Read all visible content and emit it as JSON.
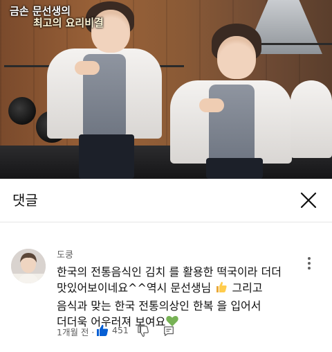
{
  "video": {
    "show_title_line1": "금손 문선생의",
    "show_title_line2": "최고의 요리비결"
  },
  "comments_panel": {
    "title": "댓글",
    "close_icon": "close-icon"
  },
  "comment": {
    "author": "도쿵",
    "text_part1": "한국의 전통음식인 김치 를 활용한 떡국이라 더더 맛있어보이네요^^역시 문선생님 ",
    "text_part2": " 그리고 음식과 맞는 한국 전통의상인 한복 을 입어서 더더욱 어우러져 보여요",
    "emoji_1": "thumbs-up-emoji",
    "emoji_2": "green-heart-emoji",
    "time": "1개월 전",
    "time_separator": "·",
    "like_count": "451",
    "icons": {
      "like": "thumbs-up-filled-icon",
      "dislike": "thumbs-down-icon",
      "reply": "reply-icon",
      "more": "more-vertical-icon"
    },
    "like_color": "#065fd4"
  }
}
